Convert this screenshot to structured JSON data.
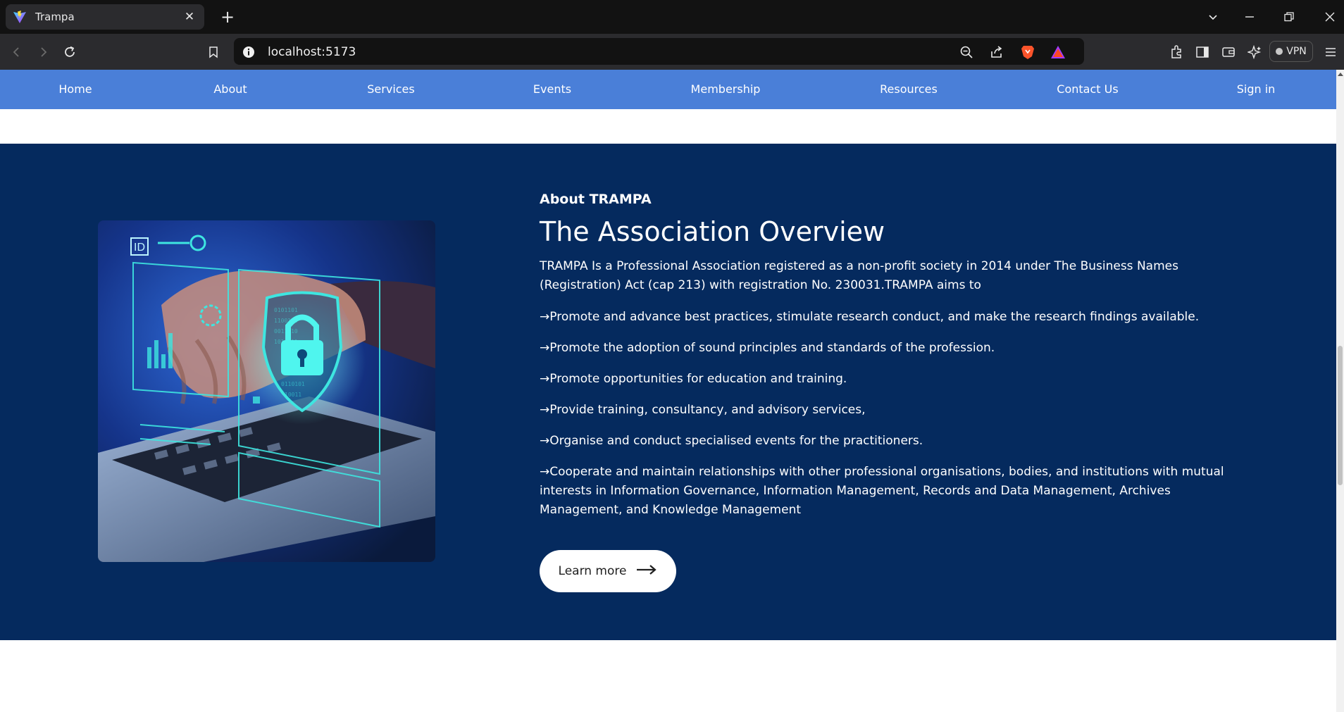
{
  "browser": {
    "tab_title": "Trampa",
    "tab_close": "✕",
    "new_tab": "+",
    "url": "localhost:5173",
    "vpn_label": "VPN"
  },
  "nav": {
    "items": [
      {
        "label": "Home"
      },
      {
        "label": "About"
      },
      {
        "label": "Services"
      },
      {
        "label": "Events"
      },
      {
        "label": "Membership"
      },
      {
        "label": "Resources"
      },
      {
        "label": "Contact Us"
      },
      {
        "label": "Sign in"
      }
    ]
  },
  "about": {
    "kicker": "About TRAMPA",
    "heading": "The Association Overview",
    "intro": "TRAMPA Is a Professional Association registered as a non-profit society in 2014 under The Business Names (Registration) Act (cap 213) with registration No. 230031.TRAMPA aims to",
    "bullets": [
      "→Promote and advance best practices, stimulate research conduct, and make the research findings available.",
      "→Promote the adoption of sound principles and standards of the profession.",
      "→Promote opportunities for education and training.",
      "→Provide training, consultancy, and advisory services,",
      "→Organise and conduct specialised events for the practitioners.",
      "→Cooperate and maintain relationships with other professional organisations, bodies, and institutions with mutual interests in Information Governance, Information Management, Records and Data Management, Archives Management, and Knowledge Management"
    ],
    "learn_more": "Learn more",
    "image_alt": "cybersecurity-laptop-image"
  },
  "colors": {
    "nav_bg": "#4a7fd8",
    "section_bg": "#052a5e",
    "accent_cyan": "#3ee6e0"
  }
}
